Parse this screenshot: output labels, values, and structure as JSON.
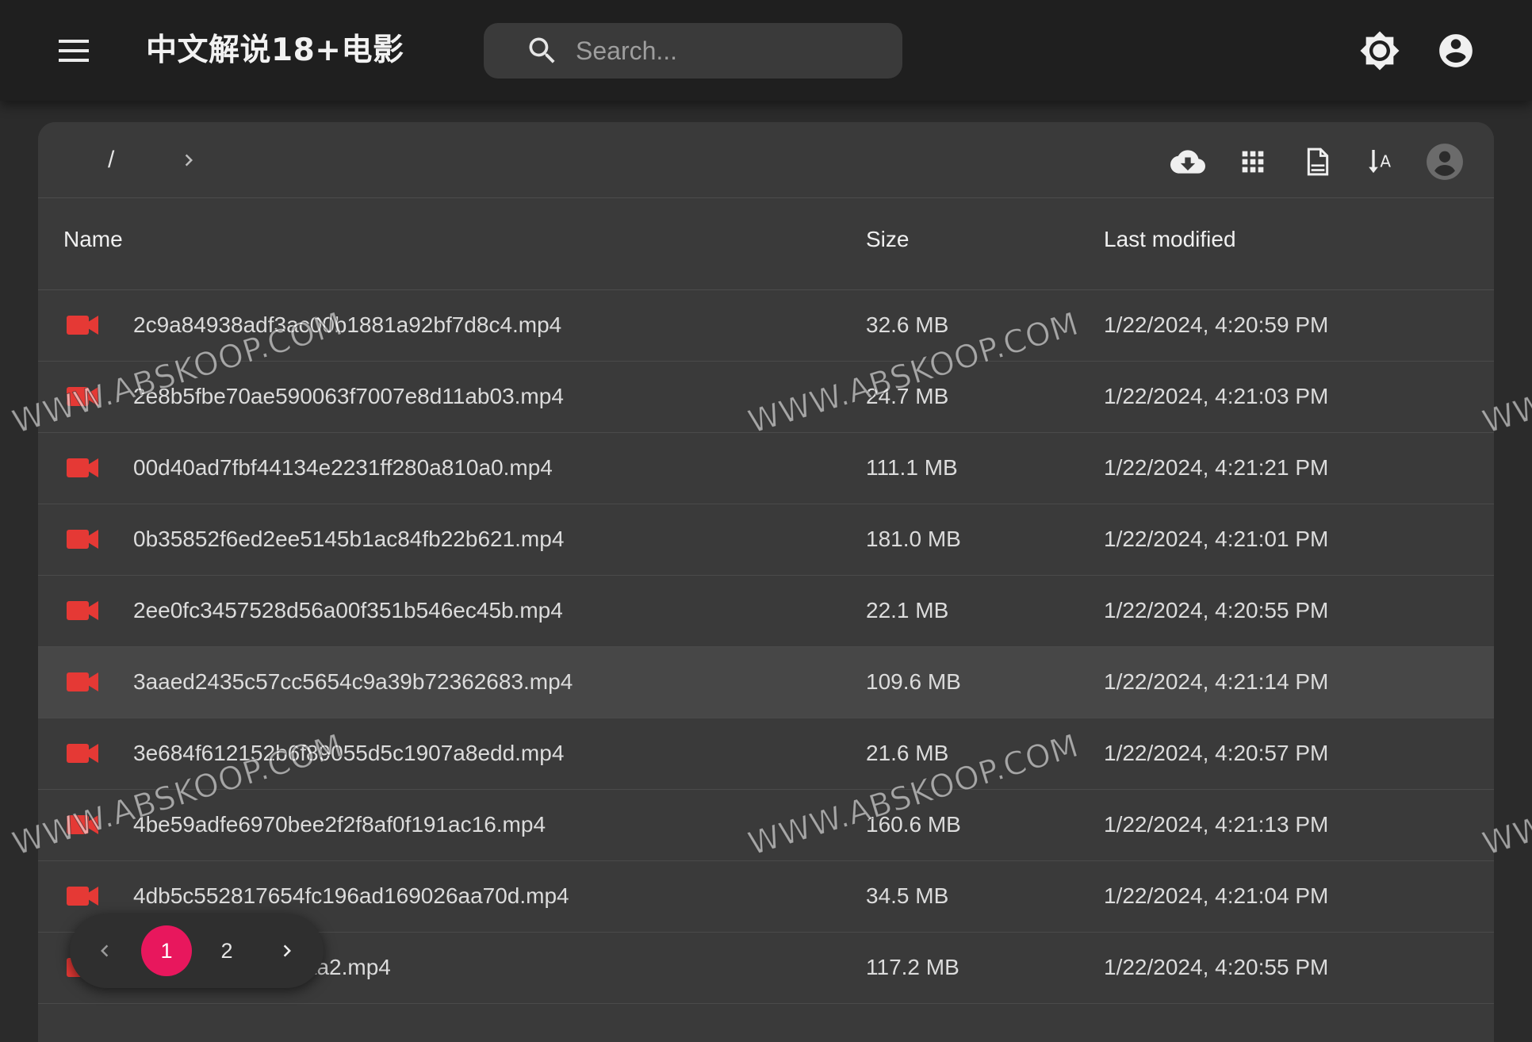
{
  "header": {
    "title": "中文解说18+电影",
    "search_placeholder": "Search...",
    "menu_icon": "hamburger-menu-icon",
    "theme_icon": "brightness-icon",
    "account_icon": "account-circle-icon"
  },
  "toolbar": {
    "breadcrumb_root": "/",
    "breadcrumb_next_icon": "chevron-right-icon",
    "buttons": [
      "cloud-download-icon",
      "grid-view-icon",
      "file-details-icon",
      "sort-alpha-icon",
      "account-icon"
    ]
  },
  "table": {
    "columns": {
      "name": "Name",
      "size": "Size",
      "modified": "Last modified"
    },
    "rows": [
      {
        "name": "2c9a84938adf3ac00b1881a92bf7d8c4.mp4",
        "size": "32.6 MB",
        "modified": "1/22/2024, 4:20:59 PM"
      },
      {
        "name": "2e8b5fbe70ae590063f7007e8d11ab03.mp4",
        "size": "24.7 MB",
        "modified": "1/22/2024, 4:21:03 PM"
      },
      {
        "name": "00d40ad7fbf44134e2231ff280a810a0.mp4",
        "size": "111.1 MB",
        "modified": "1/22/2024, 4:21:21 PM"
      },
      {
        "name": "0b35852f6ed2ee5145b1ac84fb22b621.mp4",
        "size": "181.0 MB",
        "modified": "1/22/2024, 4:21:01 PM"
      },
      {
        "name": "2ee0fc3457528d56a00f351b546ec45b.mp4",
        "size": "22.1 MB",
        "modified": "1/22/2024, 4:20:55 PM"
      },
      {
        "name": "3aaed2435c57cc5654c9a39b72362683.mp4",
        "size": "109.6 MB",
        "modified": "1/22/2024, 4:21:14 PM"
      },
      {
        "name": "3e684f612152b6f89055d5c1907a8edd.mp4",
        "size": "21.6 MB",
        "modified": "1/22/2024, 4:20:57 PM"
      },
      {
        "name": "4be59adfe6970bee2f2f8af0f191ac16.mp4",
        "size": "160.6 MB",
        "modified": "1/22/2024, 4:21:13 PM"
      },
      {
        "name": "4db5c552817654fc196ad169026aa70d.mp4",
        "size": "34.5 MB",
        "modified": "1/22/2024, 4:21:04 PM"
      },
      {
        "name": "...26ffd5a0fae83caa2.mp4",
        "size": "117.2 MB",
        "modified": "1/22/2024, 4:20:55 PM"
      }
    ]
  },
  "pagination": {
    "prev_icon": "chevron-left-icon",
    "next_icon": "chevron-right-icon",
    "pages": [
      "1",
      "2"
    ],
    "current": "1"
  },
  "watermark": "WWW.ABSKOOP.COM",
  "colors": {
    "accent": "#e8175d",
    "video_icon": "#e53935",
    "appbar": "#1f1f1f",
    "card": "#3a3a3a"
  }
}
